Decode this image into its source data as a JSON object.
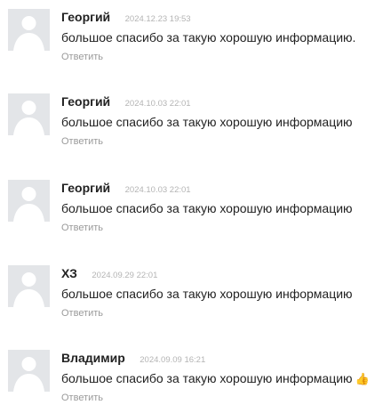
{
  "reply_label": "Ответить",
  "comments": [
    {
      "author": "Георгий",
      "date": "2024.12.23 19:53",
      "text": "большое спасибо за такую хорошую информацию.",
      "emoji": ""
    },
    {
      "author": "Георгий",
      "date": "2024.10.03 22:01",
      "text": "большое спасибо за такую хорошую информацию",
      "emoji": ""
    },
    {
      "author": "Георгий",
      "date": "2024.10.03 22:01",
      "text": "большое спасибо за такую хорошую информацию",
      "emoji": ""
    },
    {
      "author": "ХЗ",
      "date": "2024.09.29 22:01",
      "text": "большое спасибо за такую хорошую информацию",
      "emoji": ""
    },
    {
      "author": "Владимир",
      "date": "2024.09.09 16:21",
      "text": "большое спасибо за такую хорошую информацию",
      "emoji": "👍"
    }
  ]
}
